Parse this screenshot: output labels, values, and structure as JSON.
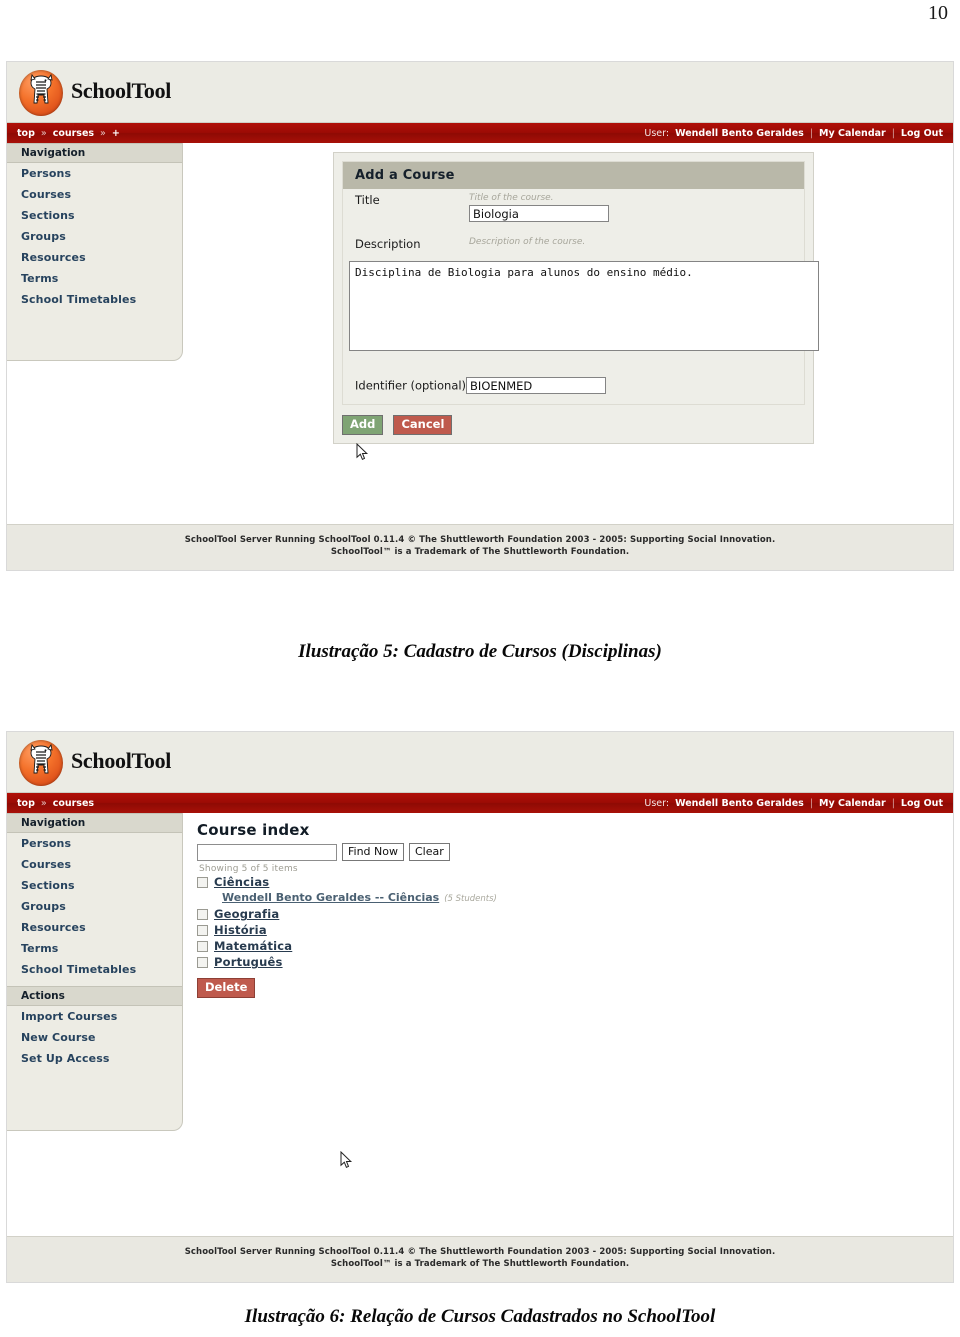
{
  "page_number": "10",
  "brand": {
    "name": "SchoolTool",
    "logo_icon": "schooltool-zebra-logo"
  },
  "user_bar": {
    "user_label": "User:",
    "user_name": "Wendell Bento Geraldes",
    "my_calendar": "My Calendar",
    "log_out": "Log Out",
    "separator": "|"
  },
  "screenshot_1": {
    "breadcrumbs": [
      "top",
      "courses",
      "+"
    ],
    "breadcrumb_separator": "»",
    "sidebar": {
      "sections": [
        {
          "heading": "Navigation",
          "items": [
            "Persons",
            "Courses",
            "Sections",
            "Groups",
            "Resources",
            "Terms",
            "School Timetables"
          ]
        }
      ]
    },
    "form": {
      "title": "Add a Course",
      "fields": {
        "title": {
          "label": "Title",
          "hint": "Title of the course.",
          "value": "Biologia",
          "placeholder": ""
        },
        "description": {
          "label": "Description",
          "hint": "Description of the course.",
          "value": "Disciplina de Biologia para alunos do ensino médio.",
          "placeholder": ""
        },
        "identifier": {
          "label": "Identifier (optional)",
          "value": "BIOENMED",
          "placeholder": ""
        }
      },
      "buttons": {
        "add": "Add",
        "cancel": "Cancel"
      }
    },
    "footer": {
      "line1": "SchoolTool Server Running SchoolTool 0.11.4 © The Shuttleworth Foundation 2003 - 2005: Supporting Social Innovation.",
      "line2": "SchoolTool™ is a Trademark of The Shuttleworth Foundation."
    },
    "caption": "Ilustração 5: Cadastro de Cursos (Disciplinas)"
  },
  "screenshot_2": {
    "breadcrumbs": [
      "top",
      "courses"
    ],
    "breadcrumb_separator": "»",
    "sidebar": {
      "sections": [
        {
          "heading": "Navigation",
          "items": [
            "Persons",
            "Courses",
            "Sections",
            "Groups",
            "Resources",
            "Terms",
            "School Timetables"
          ]
        },
        {
          "heading": "Actions",
          "items": [
            "Import Courses",
            "New Course",
            "Set Up Access"
          ]
        }
      ]
    },
    "course_index": {
      "title": "Course index",
      "search": {
        "value": "",
        "placeholder": "",
        "find_now": "Find Now",
        "clear": "Clear"
      },
      "showing": "Showing 5 of 5 items",
      "courses": [
        {
          "name": "Ciências",
          "checked": false,
          "sections": [
            {
              "label": "Wendell Bento Geraldes -- Ciências",
              "count": "(5 Students)"
            }
          ]
        },
        {
          "name": "Geografia",
          "checked": false,
          "sections": []
        },
        {
          "name": "História",
          "checked": false,
          "sections": []
        },
        {
          "name": "Matemática",
          "checked": false,
          "sections": []
        },
        {
          "name": "Português",
          "checked": false,
          "sections": []
        }
      ],
      "delete_button": "Delete"
    },
    "footer": {
      "line1": "SchoolTool Server Running SchoolTool 0.11.4 © The Shuttleworth Foundation 2003 - 2005: Supporting Social Innovation.",
      "line2": "SchoolTool™ is a Trademark of The Shuttleworth Foundation."
    },
    "caption": "Ilustração 6: Relação de Cursos Cadastrados no SchoolTool"
  },
  "colors": {
    "navbar_red": "#9c0b05",
    "header_bg": "#ebebe4",
    "sidebar_bg": "#edece4",
    "sidebar_heading_bg": "#d9d8cd",
    "form_title_bg": "#b9b8a9",
    "add_button": "#7fa474",
    "cancel_button": "#bf5a4d",
    "link_blue": "#27435e"
  }
}
